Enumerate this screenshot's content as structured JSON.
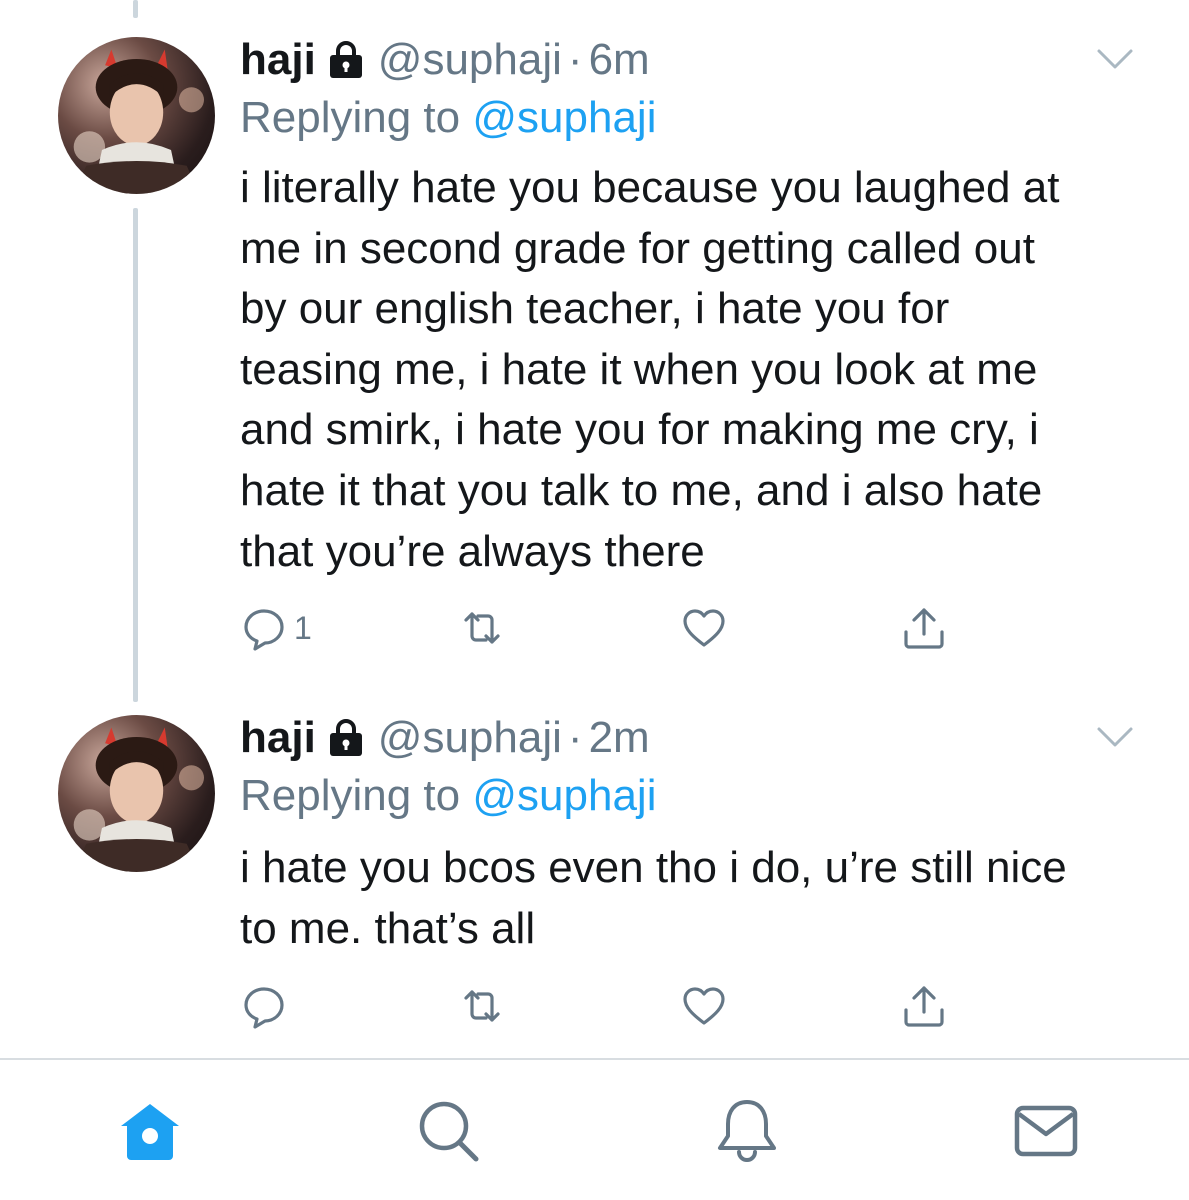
{
  "colors": {
    "accent": "#1da1f2",
    "text": "#14171a",
    "secondary": "#657786",
    "thread_line": "#ccd6dd",
    "icon": "#657786",
    "home_active": "#1da1f2"
  },
  "tweets": [
    {
      "name": "haji",
      "lock_icon": "lock-icon",
      "handle": "@suphaji",
      "separator": "·",
      "time": "6m",
      "replying_prefix": "Replying to",
      "replying_to": "@suphaji",
      "body": "i literally hate you because you laughed at\nme in second grade for getting called out\nby our english teacher, i hate you for\nteasing me, i hate it when you look at me\nand smirk, i hate you for making me cry, i\nhate it that you talk to me, and i also hate\nthat you’re always there",
      "reply_count": "1"
    },
    {
      "name": "haji",
      "lock_icon": "lock-icon",
      "handle": "@suphaji",
      "separator": "·",
      "time": "2m",
      "replying_prefix": "Replying to",
      "replying_to": "@suphaji",
      "body": "i hate you bcos even tho i do, u’re still nice\nto me. that’s all",
      "reply_count": ""
    }
  ],
  "tabbar": {
    "items": [
      "home-icon",
      "search-icon",
      "notifications-icon",
      "messages-icon"
    ],
    "active": "home-icon"
  }
}
